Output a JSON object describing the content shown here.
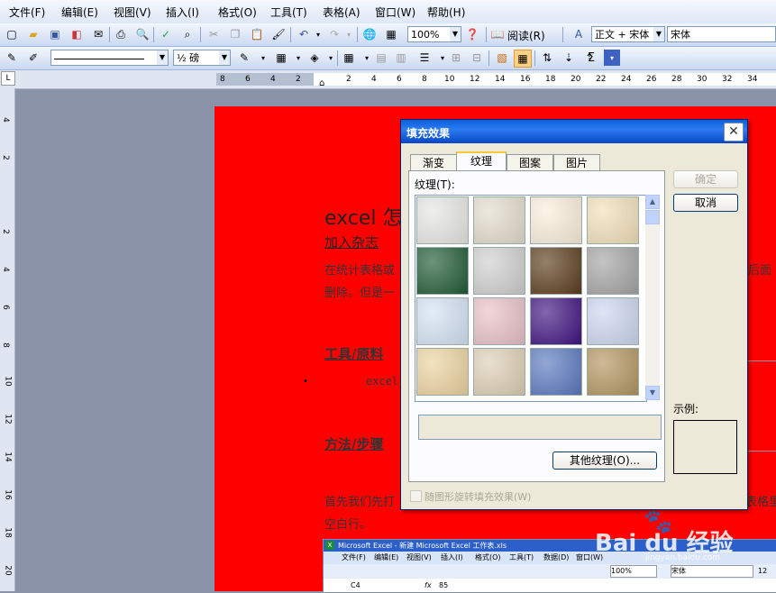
{
  "menu": [
    "文件(F)",
    "编辑(E)",
    "视图(V)",
    "插入(I)",
    "格式(O)",
    "工具(T)",
    "表格(A)",
    "窗口(W)",
    "帮助(H)"
  ],
  "toolbar1": {
    "zoom": "100%",
    "read_label": "阅读(R)",
    "style": "正文 + 宋体",
    "font": "宋体"
  },
  "toolbar2": {
    "line_weight": "½ 磅"
  },
  "ruler": {
    "h_left": [
      "8",
      "6",
      "4",
      "2"
    ],
    "h_right": [
      "2",
      "4",
      "6",
      "8",
      "10",
      "12",
      "14",
      "16",
      "18",
      "20",
      "22",
      "24",
      "26",
      "28",
      "30",
      "32",
      "34"
    ],
    "v": [
      "4",
      "2",
      "2",
      "4",
      "6",
      "8",
      "10",
      "12",
      "14",
      "16",
      "18",
      "20"
    ]
  },
  "doc": {
    "title": "excel 怎",
    "subtitle": "加入杂志",
    "para1": "在统计表格或",
    "para1_tail": "后面",
    "para2": "删除。但是一",
    "tools_heading": "工具/原料",
    "tools_item": "excel",
    "steps_heading": "方法/步骤",
    "step1": "首先我们先打",
    "step1_tail": "表格里",
    "step2": "空白行。"
  },
  "dialog": {
    "title": "填充效果",
    "tabs": [
      "渐变",
      "纹理",
      "图案",
      "图片"
    ],
    "texture_label": "纹理(T):",
    "ok": "确定",
    "cancel": "取消",
    "other_textures": "其他纹理(O)...",
    "sample_label": "示例:",
    "rotate_checkbox": "随图形旋转填充效果(W)"
  },
  "textures": [
    {
      "name": "white-marble",
      "color": "#e6e6e2"
    },
    {
      "name": "beige-paper",
      "color": "#e3dccc"
    },
    {
      "name": "cream-paper",
      "color": "#fbeedb"
    },
    {
      "name": "parchment",
      "color": "#f1dfb8"
    },
    {
      "name": "green-marble",
      "color": "#1f5a34"
    },
    {
      "name": "gray-marble",
      "color": "#cfcfcf"
    },
    {
      "name": "brown-fur",
      "color": "#5b3c1c"
    },
    {
      "name": "granite",
      "color": "#a4a4a4"
    },
    {
      "name": "blue-tissue",
      "color": "#d4e2f3"
    },
    {
      "name": "pink-tissue",
      "color": "#e8c0c6"
    },
    {
      "name": "purple-mesh",
      "color": "#3e1380"
    },
    {
      "name": "bouquet",
      "color": "#ccd6ee"
    },
    {
      "name": "papyrus",
      "color": "#ecd3a0"
    },
    {
      "name": "canvas",
      "color": "#ddcfb4"
    },
    {
      "name": "denim",
      "color": "#5a78be"
    },
    {
      "name": "woven-mat",
      "color": "#b39560"
    }
  ],
  "excel": {
    "title": "Microsoft Excel - 新建 Microsoft Excel 工作表.xls",
    "menu": [
      "文件(F)",
      "编辑(E)",
      "视图(V)",
      "插入(I)",
      "格式(O)",
      "工具(T)",
      "数据(D)",
      "窗口(W)"
    ],
    "zoom": "100%",
    "font": "宋体",
    "size": "12",
    "cell": "C4",
    "value": "85"
  },
  "watermark": "Bai du 经验",
  "watermark_url": "jingyan.baidu.com",
  "colors": {
    "page_red": "#ff0000",
    "dialog_face": "#ece9d8",
    "title_blue": "#0a5fd8"
  }
}
